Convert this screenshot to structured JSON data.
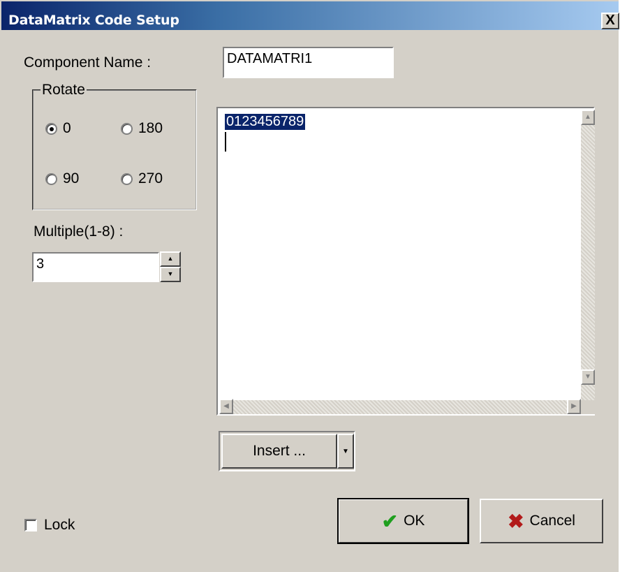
{
  "window": {
    "title": "DataMatrix Code Setup",
    "close_glyph": "X"
  },
  "form": {
    "component_name_label": "Component Name :",
    "component_name_value": "DATAMATRI1",
    "rotate": {
      "legend": "Rotate",
      "options": [
        "0",
        "180",
        "90",
        "270"
      ],
      "selected": "0"
    },
    "multiple_label": "Multiple(1-8) :",
    "multiple_value": "3",
    "content_text": "0123456789",
    "insert_label": "Insert ...",
    "lock_label": "Lock",
    "lock_checked": false
  },
  "buttons": {
    "ok": "OK",
    "cancel": "Cancel"
  },
  "icons": {
    "ok": "check-icon",
    "cancel": "x-icon"
  }
}
